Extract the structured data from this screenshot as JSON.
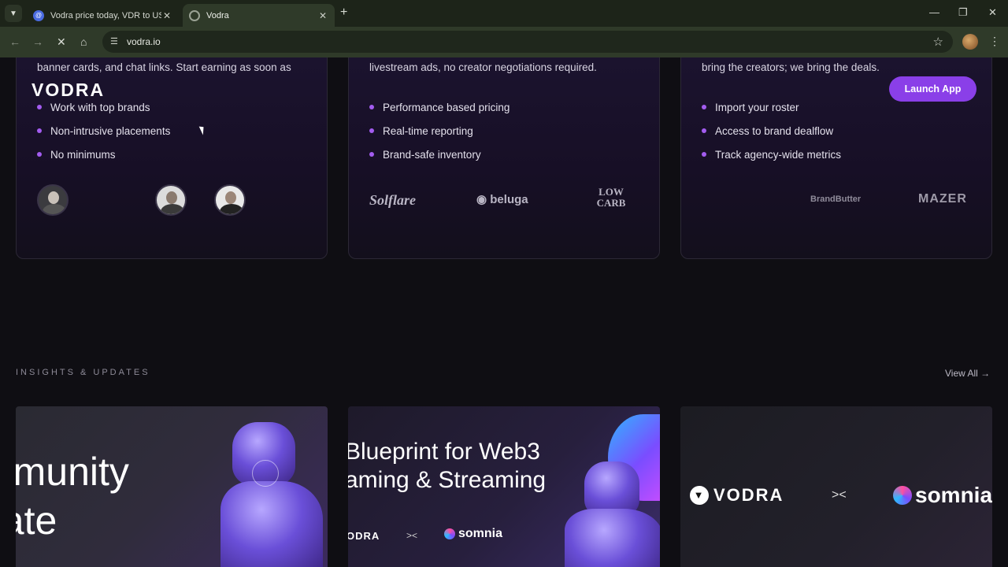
{
  "browser": {
    "tabs": [
      {
        "title": "Vodra price today, VDR to USD",
        "favicon": "coin-icon",
        "active": false
      },
      {
        "title": "Vodra",
        "favicon": "loading-icon",
        "active": true
      }
    ],
    "url": "vodra.io"
  },
  "site": {
    "logo": "VODRA",
    "launch_label": "Launch App"
  },
  "cards": [
    {
      "desc": "banner cards, and chat links. Start earning as soon as",
      "features": [
        "Work with top brands",
        "Non-intrusive placements",
        "No minimums"
      ]
    },
    {
      "desc": "livestream ads, no creator negotiations required.",
      "features": [
        "Performance based pricing",
        "Real-time reporting",
        "Brand-safe inventory"
      ],
      "brands": [
        "Solflare",
        "beluga",
        "LOW CARB"
      ]
    },
    {
      "desc": "bring the creators; we bring the deals.",
      "features": [
        "Import your roster",
        "Access to brand dealflow",
        "Track agency-wide metrics"
      ],
      "brands": [
        "BrandButter",
        "MAZER"
      ]
    }
  ],
  "insights": {
    "label": "INSIGHTS & UPDATES",
    "view_all": "View All →",
    "posts": [
      {
        "title_line1": "mmunity",
        "title_line2": "date"
      },
      {
        "title_line1": "Blueprint for Web3",
        "title_line2": "aming & Streaming",
        "partner_a": "ODRA",
        "separator": "><",
        "partner_b": "somnia"
      },
      {
        "partner_a": "VODRA",
        "separator": "><",
        "partner_b": "somnia"
      }
    ]
  }
}
